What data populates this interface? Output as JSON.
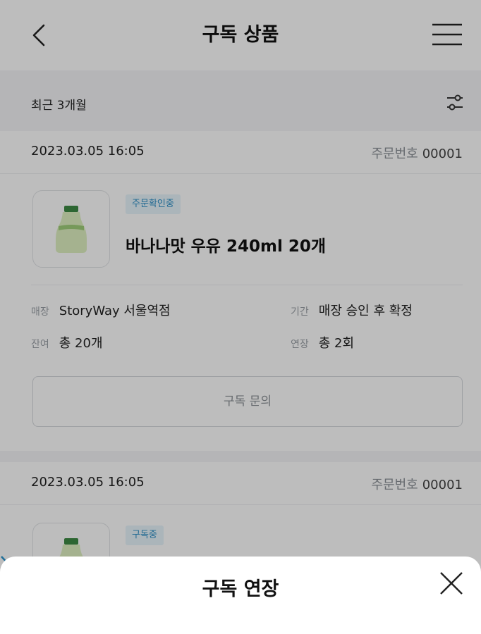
{
  "header": {
    "title": "구독 상품"
  },
  "filter": {
    "label": "최근 3개월"
  },
  "orders": [
    {
      "date": "2023.03.05 16:05",
      "order_no_label": "주문번호",
      "order_no": "00001",
      "status": "주문확인중",
      "product": "바나나맛 우유 240ml 20개",
      "store_label": "매장",
      "store": "StoryWay 서울역점",
      "period_label": "기간",
      "period": "매장 승인 후 확정",
      "remaining_label": "잔여",
      "remaining": "총 20개",
      "extension_label": "연장",
      "extension": "총 2회",
      "inquiry_button": "구독 문의"
    },
    {
      "date": "2023.03.05 16:05",
      "order_no_label": "주문번호",
      "order_no": "00001",
      "status": "구독중"
    }
  ],
  "sheet": {
    "title": "구독 연장"
  },
  "colors": {
    "accent": "#2d8fc7",
    "badge_bg": "#e7f4fb",
    "annotation_arrow": "#1f6f99"
  }
}
